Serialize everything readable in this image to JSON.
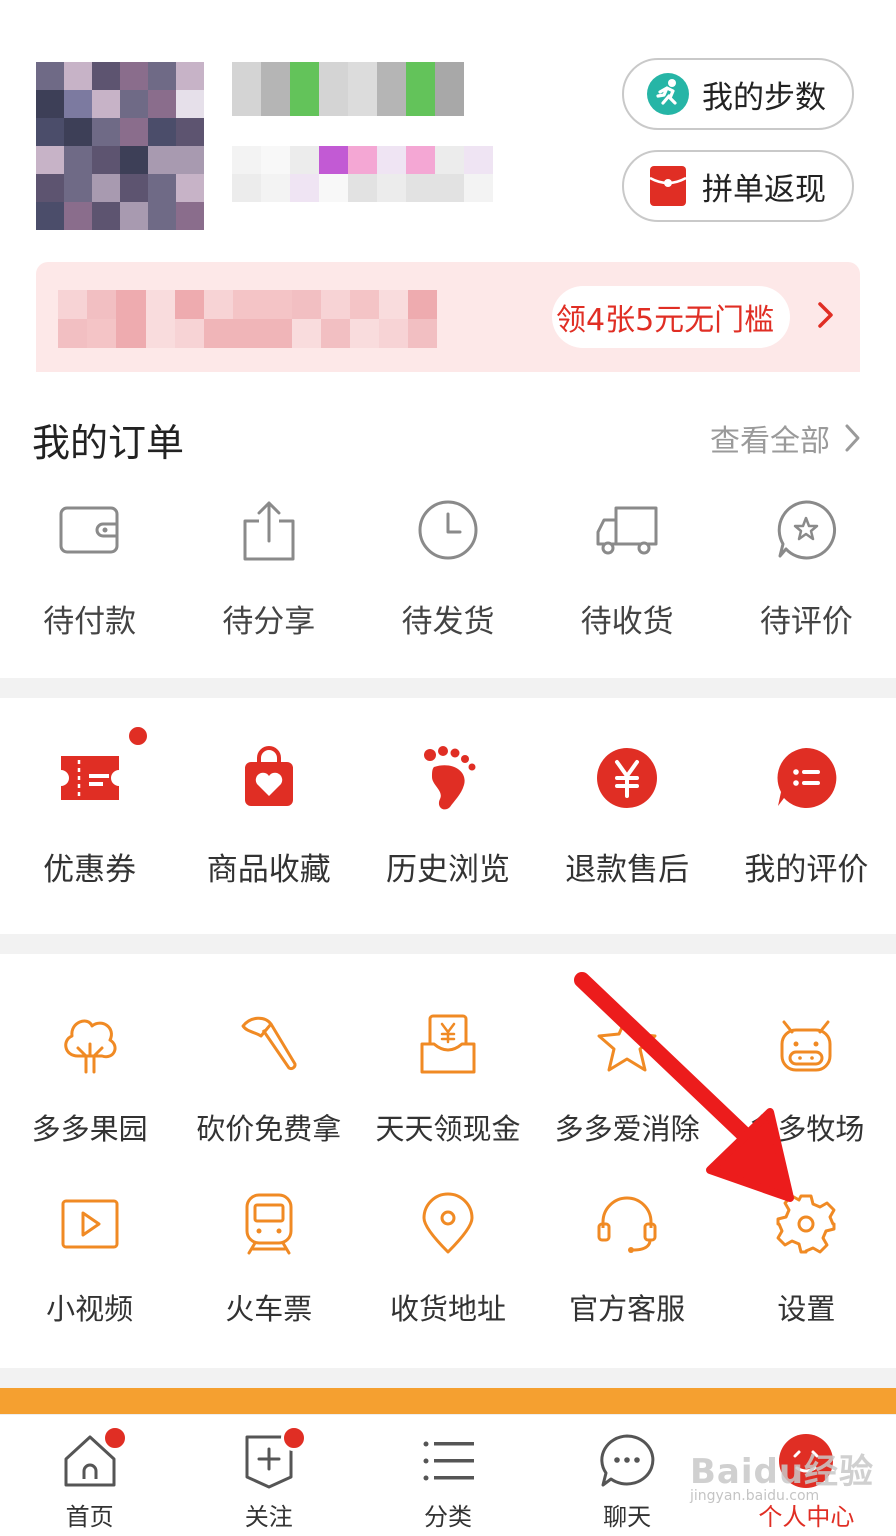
{
  "header": {
    "steps_button": "我的步数",
    "group_cashback_button": "拼单返现",
    "coupon_pill": "领4张5元无门槛"
  },
  "orders": {
    "title": "我的订单",
    "view_all": "查看全部",
    "items": [
      {
        "label": "待付款",
        "icon": "wallet-icon"
      },
      {
        "label": "待分享",
        "icon": "share-icon"
      },
      {
        "label": "待发货",
        "icon": "clock-icon"
      },
      {
        "label": "待收货",
        "icon": "truck-icon"
      },
      {
        "label": "待评价",
        "icon": "star-bubble-icon"
      }
    ]
  },
  "services": {
    "items": [
      {
        "label": "优惠券",
        "icon": "coupon-icon",
        "badge": true
      },
      {
        "label": "商品收藏",
        "icon": "heart-bag-icon"
      },
      {
        "label": "历史浏览",
        "icon": "footprint-icon"
      },
      {
        "label": "退款售后",
        "icon": "yuan-icon"
      },
      {
        "label": "我的评价",
        "icon": "comment-list-icon"
      }
    ]
  },
  "tools": {
    "row1": [
      {
        "label": "多多果园",
        "icon": "tree-icon"
      },
      {
        "label": "砍价免费拿",
        "icon": "axe-icon"
      },
      {
        "label": "天天领现金",
        "icon": "cash-envelope-icon"
      },
      {
        "label": "多多爱消除",
        "icon": "star-icon"
      },
      {
        "label": "多多牧场",
        "icon": "cow-icon"
      }
    ],
    "row2": [
      {
        "label": "小视频",
        "icon": "video-icon"
      },
      {
        "label": "火车票",
        "icon": "train-icon"
      },
      {
        "label": "收货地址",
        "icon": "location-icon"
      },
      {
        "label": "官方客服",
        "icon": "headset-icon"
      },
      {
        "label": "设置",
        "icon": "gear-icon"
      }
    ]
  },
  "tabbar": {
    "items": [
      {
        "label": "首页",
        "icon": "home-icon",
        "badge": true
      },
      {
        "label": "关注",
        "icon": "follow-icon",
        "badge": true
      },
      {
        "label": "分类",
        "icon": "list-icon"
      },
      {
        "label": "聊天",
        "icon": "chat-icon"
      },
      {
        "label": "个人中心",
        "icon": "profile-icon",
        "active": true
      }
    ]
  },
  "watermark": {
    "text": "Baidu经验",
    "sub": "jingyan.baidu.com"
  },
  "colors": {
    "brand_red": "#e02e24",
    "orange": "#f08a24",
    "gray_icon": "#8a8a8a"
  }
}
